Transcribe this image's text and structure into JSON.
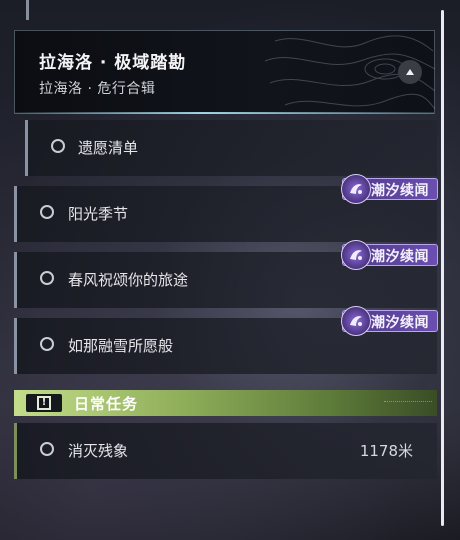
{
  "header": {
    "title": "拉海洛 · 极域踏勘",
    "subtitle": "拉海洛 · 危行合辑"
  },
  "quests": [
    {
      "label": "遗愿清单",
      "badge": ""
    },
    {
      "label": "阳光季节",
      "badge": "潮汐续闻"
    },
    {
      "label": "春风祝颂你的旅途",
      "badge": "潮汐续闻"
    },
    {
      "label": "如那融雪所愿般",
      "badge": "潮汐续闻"
    }
  ],
  "daily": {
    "title": "日常任务",
    "warning_glyph": "!",
    "quest": {
      "label": "消灭残象",
      "distance": "1178米"
    }
  },
  "colors": {
    "daily_accent": "#c3dd8a",
    "badge_purple": "#6a4fb0",
    "header_glow": "#aae6f5"
  },
  "icons": {
    "collapse": "chevron-up-icon",
    "quest_marker": "circle-icon",
    "badge_logo": "tide-logo-icon",
    "daily": "warning-icon"
  }
}
